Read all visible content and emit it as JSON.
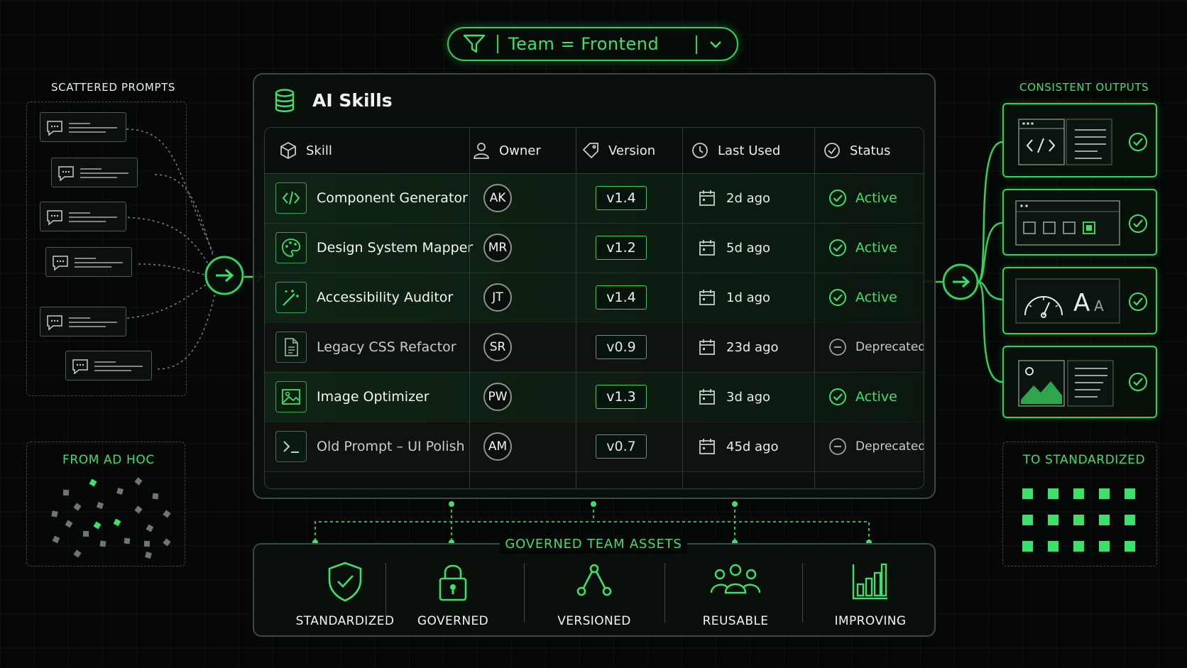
{
  "filter": {
    "text": "Team = Frontend"
  },
  "panel": {
    "title": "AI Skills"
  },
  "columns": {
    "skill": "Skill",
    "owner": "Owner",
    "version": "Version",
    "last_used": "Last Used",
    "status": "Status"
  },
  "rows": [
    {
      "skill": "Component Generator",
      "owner": "AK",
      "version": "v1.4",
      "last_used": "2d ago",
      "status": "Active",
      "icon": "code-icon"
    },
    {
      "skill": "Design System Mapper",
      "owner": "MR",
      "version": "v1.2",
      "last_used": "5d ago",
      "status": "Active",
      "icon": "palette-icon"
    },
    {
      "skill": "Accessibility Auditor",
      "owner": "JT",
      "version": "v1.4",
      "last_used": "1d ago",
      "status": "Active",
      "icon": "magic-wand-icon"
    },
    {
      "skill": "Legacy CSS Refactor",
      "owner": "SR",
      "version": "v0.9",
      "last_used": "23d ago",
      "status": "Deprecated",
      "icon": "document-icon"
    },
    {
      "skill": "Image Optimizer",
      "owner": "PW",
      "version": "v1.3",
      "last_used": "3d ago",
      "status": "Active",
      "icon": "image-icon"
    },
    {
      "skill": "Old Prompt – UI Polish",
      "owner": "AM",
      "version": "v0.7",
      "last_used": "45d ago",
      "status": "Deprecated",
      "icon": "terminal-icon"
    }
  ],
  "left": {
    "scattered_label": "SCATTERED PROMPTS",
    "adhoc_label": "FROM AD HOC"
  },
  "right": {
    "outputs_label": "CONSISTENT OUTPUTS",
    "standardized_label": "TO STANDARDIZED"
  },
  "assets": {
    "title": "GOVERNED TEAM ASSETS",
    "items": [
      {
        "label": "STANDARDIZED",
        "icon": "shield-check-icon"
      },
      {
        "label": "GOVERNED",
        "icon": "lock-icon"
      },
      {
        "label": "VERSIONED",
        "icon": "branch-icon"
      },
      {
        "label": "REUSABLE",
        "icon": "team-icon"
      },
      {
        "label": "IMPROVING",
        "icon": "bar-chart-icon"
      }
    ]
  },
  "colors": {
    "accent": "#2fd35b",
    "accent_text": "#3ee06a",
    "border": "#3a4a3e",
    "background": "#050806"
  }
}
